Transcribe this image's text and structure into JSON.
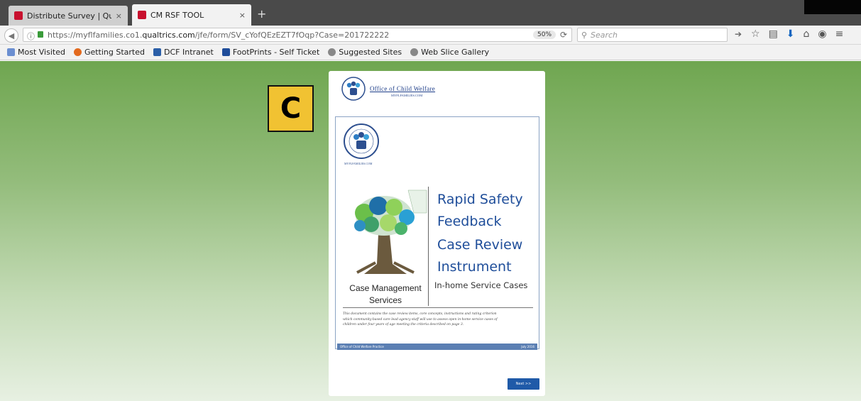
{
  "tabs": [
    {
      "title": "Distribute Survey | Qualtric...",
      "close": "×"
    },
    {
      "title": "CM RSF TOOL",
      "close": "×"
    }
  ],
  "new_tab": "+",
  "nav": {
    "info_glyph": "ⓘ",
    "url_prefix": "https://myflfamilies.co1.",
    "url_domain": "qualtrics.com",
    "url_path": "/jfe/form/SV_cYofQEzEZT7fOqp?Case=201722222",
    "zoom": "50%",
    "search_placeholder": "Search"
  },
  "bookmarks": [
    {
      "label": "Most Visited",
      "icon": "bookmark-folder-icon",
      "color": "#6b8fd1"
    },
    {
      "label": "Getting Started",
      "icon": "firefox-icon",
      "color": "#e36a1e"
    },
    {
      "label": "DCF Intranet",
      "icon": "dcf-icon",
      "color": "#2b5fa8"
    },
    {
      "label": "FootPrints - Self Ticket",
      "icon": "footprints-icon",
      "color": "#1f4d9a"
    },
    {
      "label": "Suggested Sites",
      "icon": "globe-icon",
      "color": "#888888"
    },
    {
      "label": "Web Slice Gallery",
      "icon": "globe-icon",
      "color": "#888888"
    }
  ],
  "badge": "C",
  "form": {
    "header_title": "Office of Child Welfare",
    "header_sub": "MYFLFAMILIES.COM",
    "dcf_sub": "MYFLFAMILIES.COM",
    "title_lines": [
      "Rapid Safety",
      "Feedback",
      "Case Review",
      "Instrument"
    ],
    "subtitle": "In-home Service Cases",
    "left_caption": "Case Management Services",
    "description": "This document contains the case review items, core concepts, instructions and rating criterion which community-based care lead agency staff will use to assess open in-home service cases of children under four years of age meeting the criteria described on page 3.",
    "footer_left": "Office of Child Welfare Practice",
    "footer_right": "July 2016",
    "next_label": "Next >>"
  }
}
